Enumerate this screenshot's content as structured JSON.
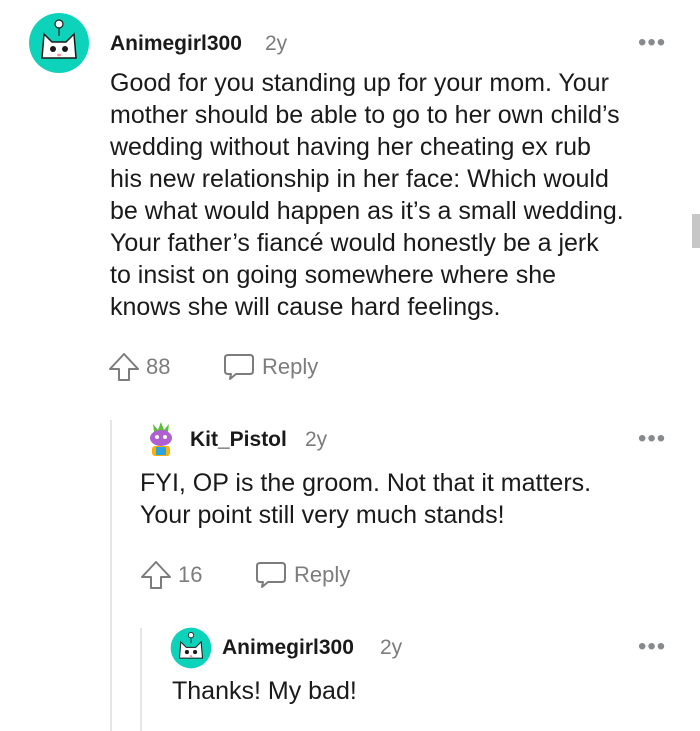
{
  "comments": [
    {
      "author": "Animegirl300",
      "age": "2y",
      "lines": [
        "Good for you standing up for your mom. Your",
        "mother should be able to go to her own child’s",
        "wedding without having her cheating ex rub",
        "his new relationship in her face: Which would",
        "be what would happen as it’s a small wedding.",
        "Your father’s fiancé would honestly be a jerk",
        "to insist on going somewhere where she",
        "knows she will cause hard feelings."
      ],
      "votes": "88",
      "reply_label": "Reply",
      "more_label": "•••"
    },
    {
      "author": "Kit_Pistol",
      "age": "2y",
      "lines": [
        "FYI, OP is the groom. Not that it matters.",
        "Your point still very much stands!"
      ],
      "votes": "16",
      "reply_label": "Reply",
      "more_label": "•••"
    },
    {
      "author": "Animegirl300",
      "age": "2y",
      "lines": [
        "Thanks! My bad!"
      ],
      "more_label": "•••"
    }
  ],
  "icons": {
    "upvote": "upvote-arrow-icon",
    "reply": "speech-bubble-icon",
    "more": "more-options-icon"
  },
  "colors": {
    "text": "#1a1a1b",
    "meta": "#7c7c7c",
    "avatar_teal": "#0dd3bb",
    "thread_line": "#e6e6e6"
  }
}
